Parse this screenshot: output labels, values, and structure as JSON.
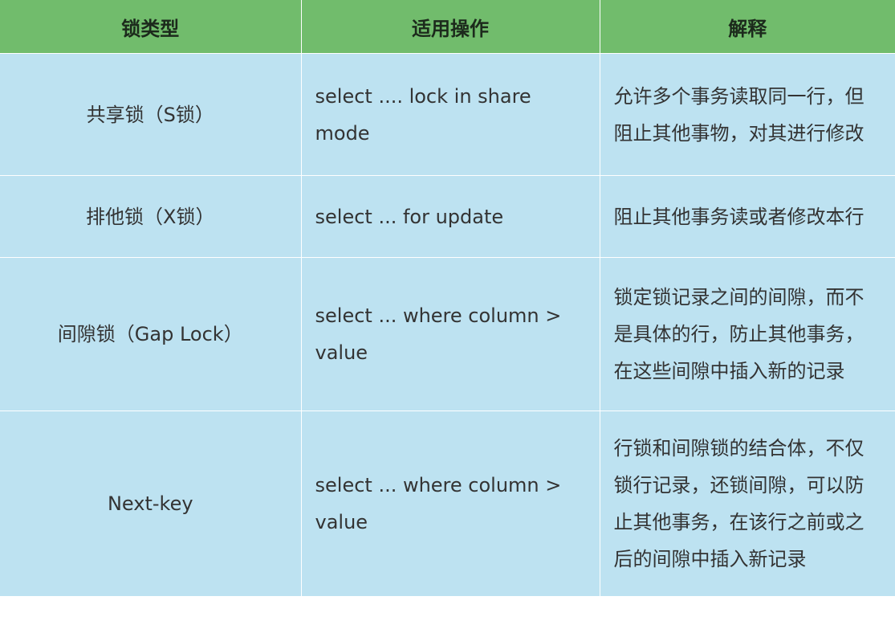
{
  "table": {
    "headers": [
      "锁类型",
      "适用操作",
      "解释"
    ],
    "rows": [
      {
        "type": "共享锁（S锁）",
        "operation": "select .... lock in share mode",
        "description": "允许多个事务读取同一行，但阻止其他事物，对其进行修改"
      },
      {
        "type": "排他锁（X锁）",
        "operation": "select ... for update",
        "description": "阻止其他事务读或者修改本行"
      },
      {
        "type": "间隙锁（Gap Lock）",
        "operation": "select ... where column > value",
        "description": "锁定锁记录之间的间隙，而不是具体的行，防止其他事务，在这些间隙中插入新的记录"
      },
      {
        "type": "Next-key",
        "operation": "select ... where column > value",
        "description": "行锁和间隙锁的结合体，不仅锁行记录，还锁间隙，可以防止其他事务，在该行之前或之后的间隙中插入新记录"
      }
    ]
  },
  "colors": {
    "header_bg": "#71bc6c",
    "cell_bg": "#bde2f1",
    "border": "#ffffff"
  }
}
